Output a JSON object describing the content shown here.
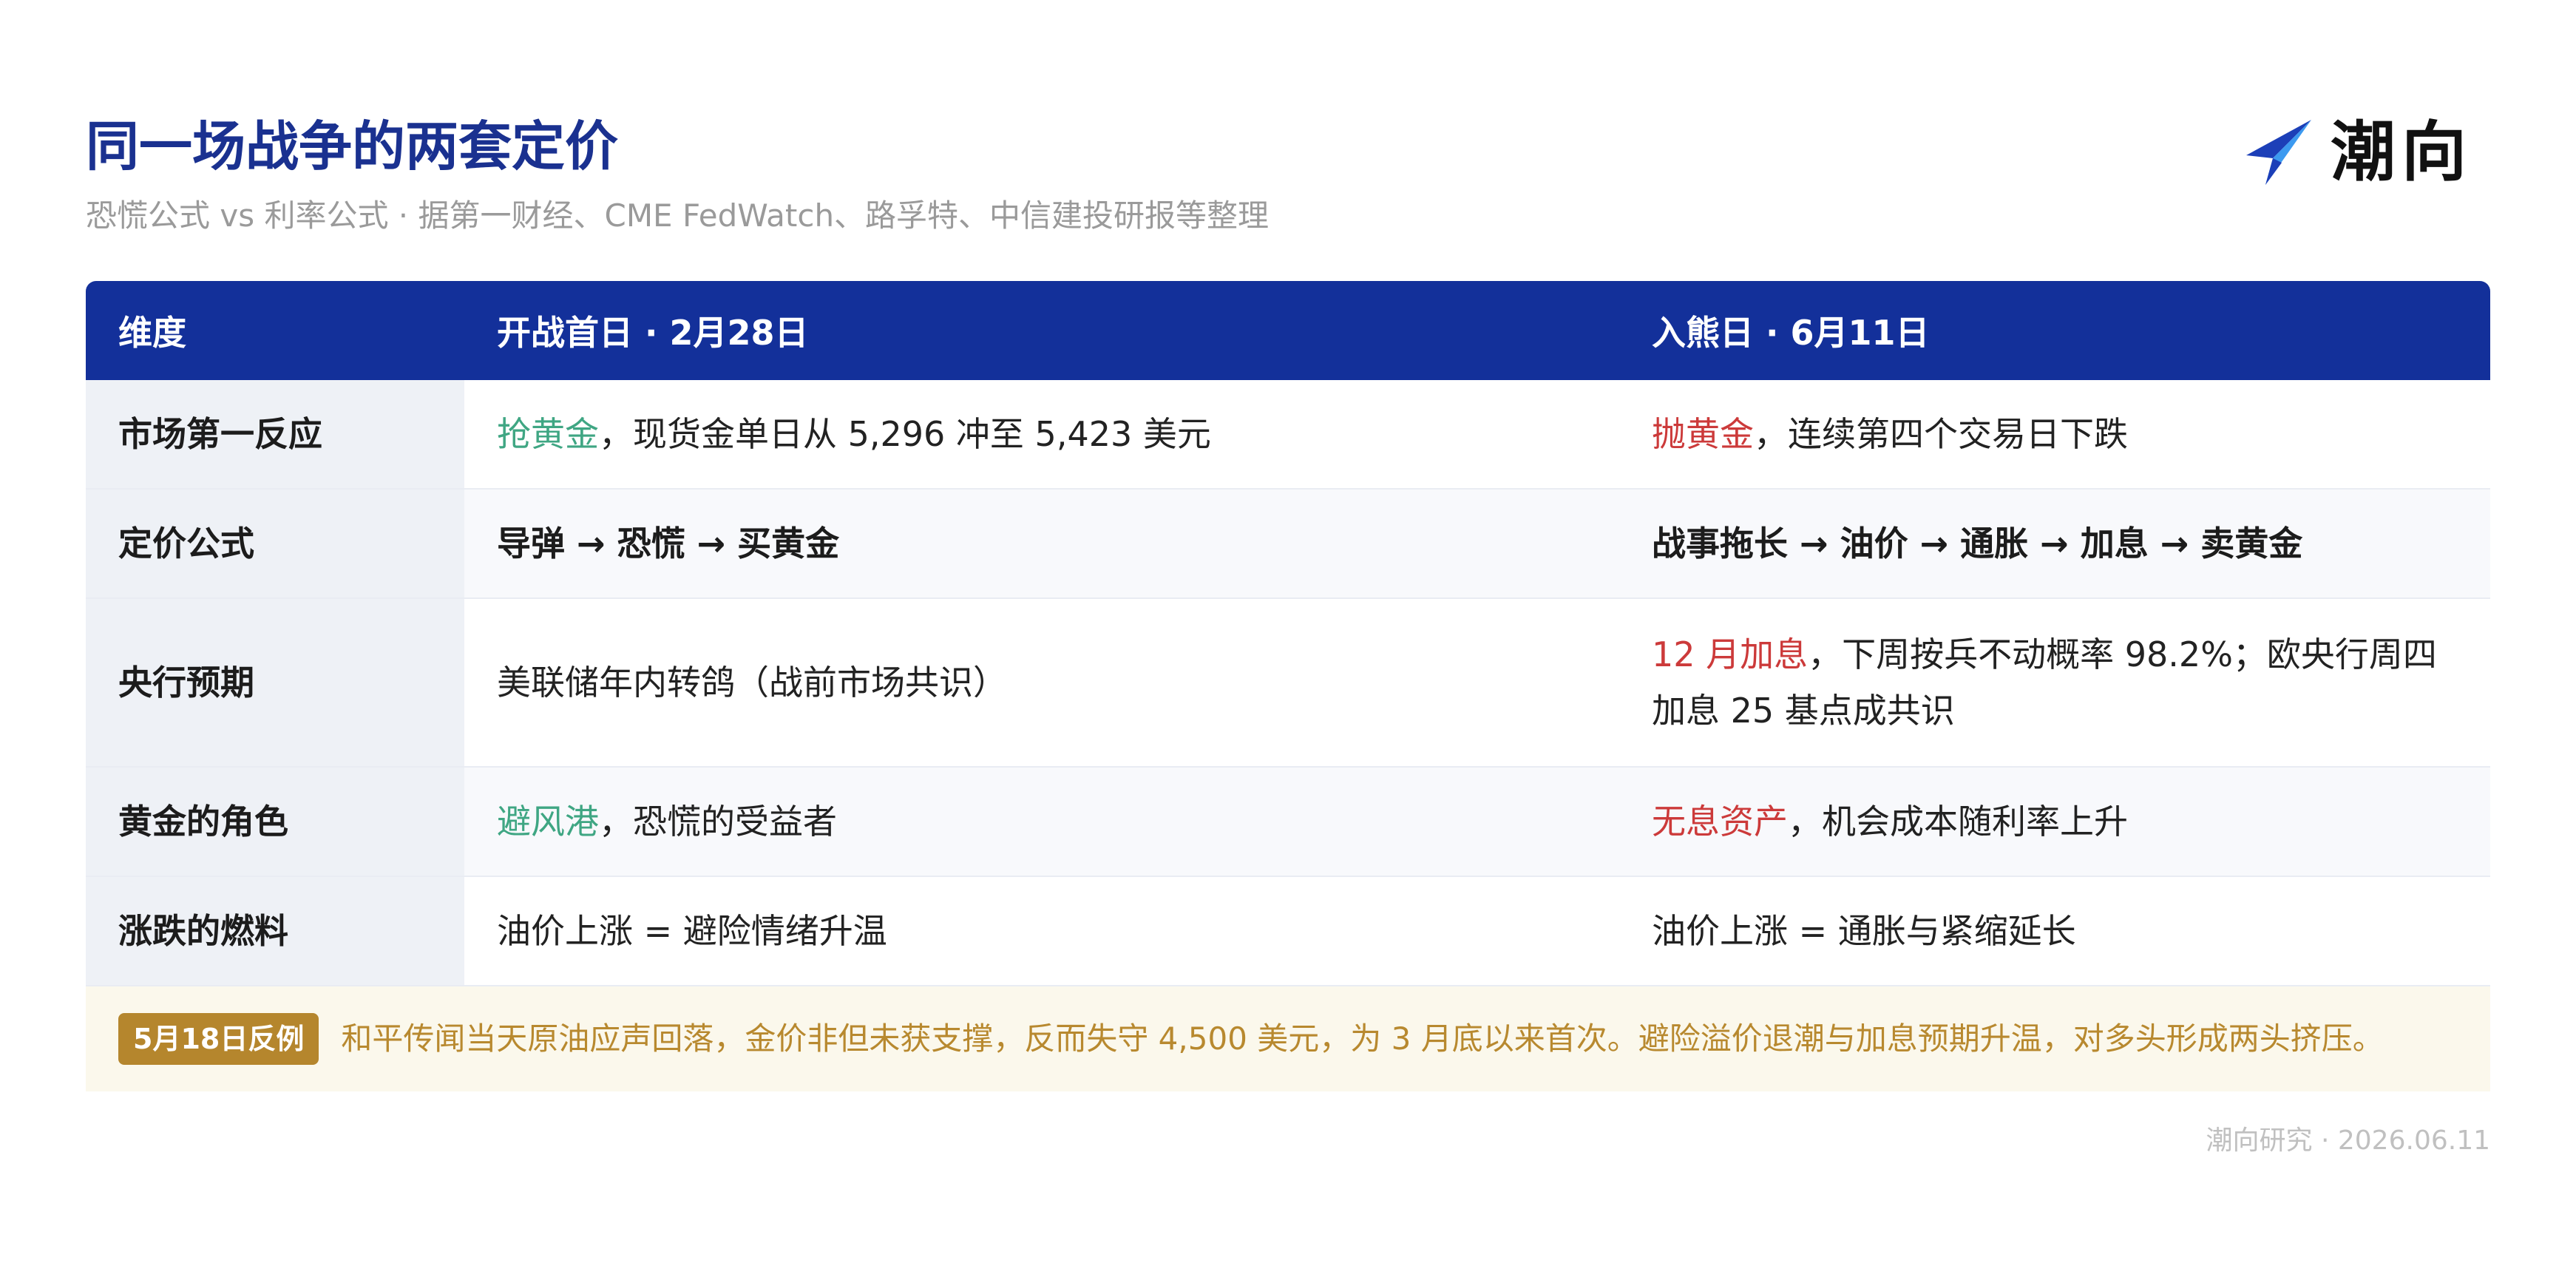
{
  "header": {
    "title": "同一场战争的两套定价",
    "subtitle": "恐慌公式 vs 利率公式 · 据第一财经、CME FedWatch、路孚特、中信建投研报等整理",
    "brand_name": "潮向",
    "brand_icon": "paper-plane-arrow-icon",
    "brand_colors": [
      "#1c3fb8",
      "#3c9af0"
    ]
  },
  "table": {
    "columns": [
      "维度",
      "开战首日 · 2月28日",
      "入熊日 · 6月11日"
    ],
    "rows": [
      {
        "dimension": "市场第一反应",
        "left": {
          "highlight": "抢黄金",
          "rest": "，现货金单日从 5,296 冲至 5,423 美元"
        },
        "right": {
          "highlight": "抛黄金",
          "rest": "，连续第四个交易日下跌"
        }
      },
      {
        "dimension": "定价公式",
        "left": {
          "text": "导弹 → 恐慌 → 买黄金"
        },
        "right": {
          "text": "战事拖长 → 油价 → 通胀 → 加息 → 卖黄金"
        }
      },
      {
        "dimension": "央行预期",
        "left": {
          "text": "美联储年内转鸽（战前市场共识）"
        },
        "right": {
          "highlight": "12 月加息",
          "rest": "，下周按兵不动概率 98.2%；欧央行周四加息 25 基点成共识"
        }
      },
      {
        "dimension": "黄金的角色",
        "left": {
          "highlight": "避风港",
          "rest": "，恐慌的受益者"
        },
        "right": {
          "highlight": "无息资产",
          "rest": "，机会成本随利率上升"
        }
      },
      {
        "dimension": "涨跌的燃料",
        "left": {
          "text": "油价上涨 = 避险情绪升温"
        },
        "right": {
          "text": "油价上涨 = 通胀与紧缩延长"
        }
      }
    ],
    "note": {
      "badge": "5月18日反例",
      "text": "和平传闻当天原油应声回落，金价非但未获支撑，反而失守 4,500 美元，为 3 月底以来首次。避险溢价退潮与加息预期升温，对多头形成两头挤压。"
    }
  },
  "footer": {
    "text": "潮向研究 · 2026.06.11"
  },
  "colors": {
    "title": "#1a3190",
    "header_bg": "#13309a",
    "positive": "#3fa683",
    "negative": "#cc3a3a",
    "note_accent": "#b5862d",
    "note_bg": "#fbf8ec"
  }
}
